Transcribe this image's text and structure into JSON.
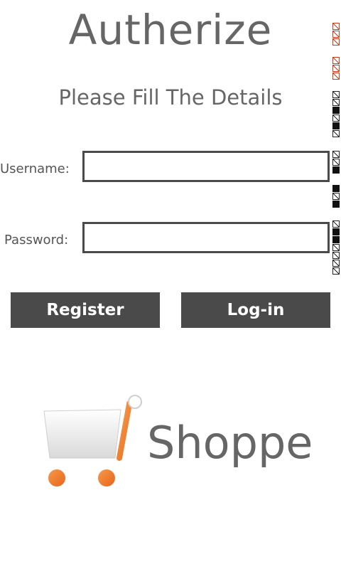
{
  "header": {
    "title": "Autherize",
    "subtitle": "Please Fill The Details"
  },
  "form": {
    "username_label": "Username:",
    "username_value": "",
    "password_label": "Password:",
    "password_value": ""
  },
  "actions": {
    "register_label": "Register",
    "login_label": "Log-in"
  },
  "brand": {
    "name": "Shoppe",
    "logo_icon": "shopping-cart-icon",
    "logo_accent": "#f07a2d"
  },
  "colors": {
    "button_bg": "#4a4a4a",
    "text": "#666666",
    "error_glyph": "#cc3b1b"
  }
}
